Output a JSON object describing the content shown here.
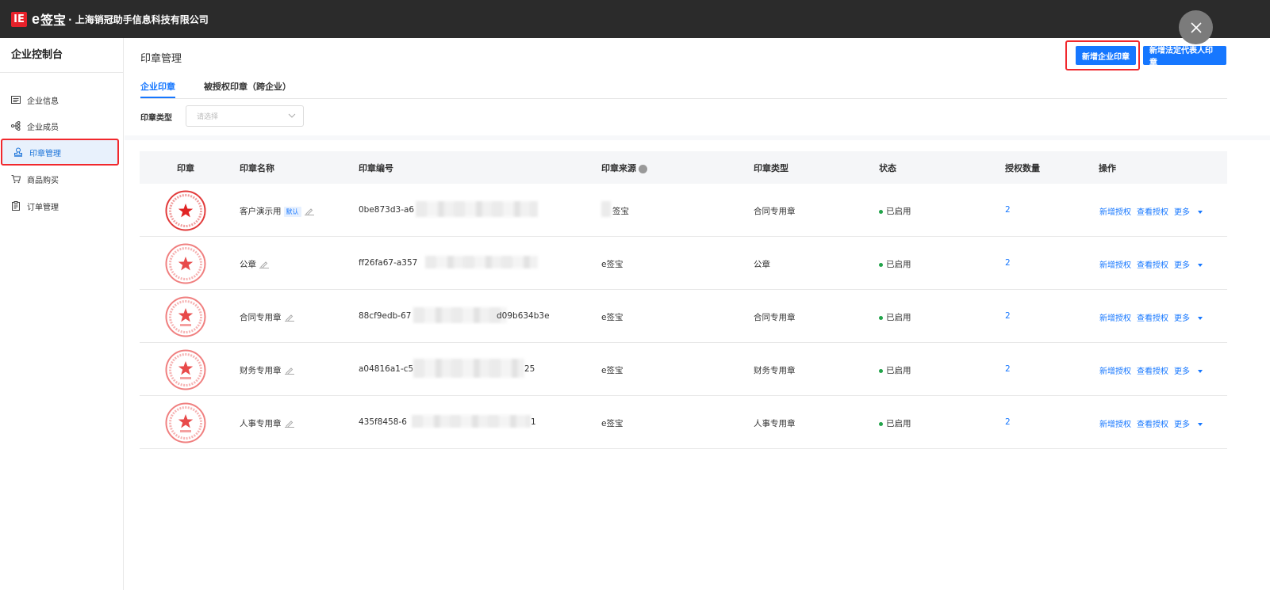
{
  "header": {
    "logo_mark": "IE",
    "logo_e": "e",
    "brand": "签宝",
    "company": "· 上海销冠助手信息科技有限公司"
  },
  "sidebar": {
    "title": "企业控制台",
    "items": [
      {
        "label": "企业信息",
        "icon": "document-icon"
      },
      {
        "label": "企业成员",
        "icon": "org-tree-icon"
      },
      {
        "label": "印章管理",
        "icon": "seal-icon"
      },
      {
        "label": "商品购买",
        "icon": "cart-icon"
      },
      {
        "label": "订单管理",
        "icon": "clipboard-icon"
      }
    ]
  },
  "main": {
    "title": "印章管理",
    "buttons": {
      "add_company_seal": "新增企业印章",
      "add_legal_seal": "新增法定代表人印章"
    },
    "tabs": [
      "企业印章",
      "被授权印章（跨企业）"
    ],
    "filter": {
      "label": "印章类型",
      "placeholder": "请选择"
    }
  },
  "table": {
    "columns": [
      "印章",
      "印章名称",
      "印章编号",
      "印章来源",
      "印章类型",
      "状态",
      "授权数量",
      "操作"
    ],
    "rows": [
      {
        "name": "客户演示用",
        "default_badge": "默认",
        "id_start": "0be873d3-a6",
        "id_end": "",
        "source": "签宝",
        "type": "合同专用章",
        "status": "已启用",
        "count": "2"
      },
      {
        "name": "公章",
        "default_badge": "",
        "id_start": "ff26fa67-a357",
        "id_end": "",
        "source": "e签宝",
        "type": "公章",
        "status": "已启用",
        "count": "2"
      },
      {
        "name": "合同专用章",
        "default_badge": "",
        "id_start": "88cf9edb-67",
        "id_end": "d09b634b3e",
        "source": "e签宝",
        "type": "合同专用章",
        "status": "已启用",
        "count": "2"
      },
      {
        "name": "财务专用章",
        "default_badge": "",
        "id_start": "a04816a1-c5",
        "id_end": "25",
        "source": "e签宝",
        "type": "财务专用章",
        "status": "已启用",
        "count": "2"
      },
      {
        "name": "人事专用章",
        "default_badge": "",
        "id_start": "435f8458-6",
        "id_end": "1",
        "source": "e签宝",
        "type": "人事专用章",
        "status": "已启用",
        "count": "2"
      }
    ],
    "ops": [
      "新增授权",
      "查看授权",
      "更多"
    ]
  },
  "colors": {
    "accent": "#1677ff",
    "highlight": "#f1282d",
    "status_ok": "#22a34a",
    "topbar": "#2b2b2b"
  }
}
